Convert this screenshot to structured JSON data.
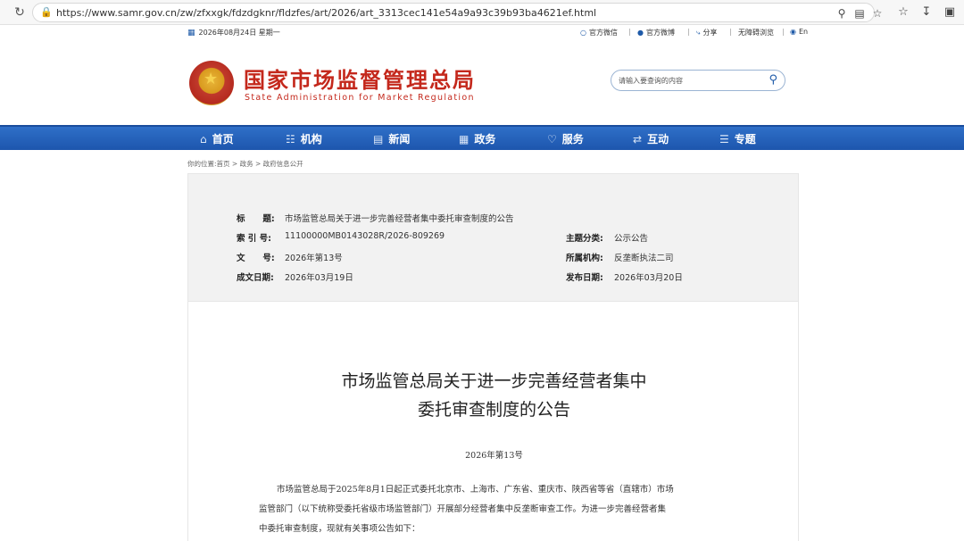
{
  "browser": {
    "url": "https://www.samr.gov.cn/zw/zfxxgk/fdzdgknr/fldzfes/art/2026/art_3313cec141e54a9a93c39b93ba4621ef.html"
  },
  "top_bar": {
    "date": "2026年08月24日 星期一",
    "links": [
      "官方微信",
      "官方微博",
      "分享",
      "无障碍浏览",
      "En"
    ]
  },
  "header": {
    "title": "国家市场监督管理总局",
    "subtitle": "State Administration for Market Regulation",
    "search_placeholder": "请输入要查询的内容"
  },
  "nav": {
    "items": [
      {
        "label": "首页",
        "icon": "home-icon"
      },
      {
        "label": "机构",
        "icon": "org-icon"
      },
      {
        "label": "新闻",
        "icon": "news-icon"
      },
      {
        "label": "政务",
        "icon": "gov-icon"
      },
      {
        "label": "服务",
        "icon": "service-icon"
      },
      {
        "label": "互动",
        "icon": "interact-icon"
      },
      {
        "label": "专题",
        "icon": "topic-icon"
      }
    ]
  },
  "breadcrumb": "你的位置:首页 > 政务 > 政府信息公开",
  "meta": {
    "title_label": "标      题:",
    "title_value": "市场监管总局关于进一步完善经营者集中委托审查制度的公告",
    "index_label": "索 引 号:",
    "index_value": "11100000MB0143028R/2026-809269",
    "doc_label": "文      号:",
    "doc_value": "2026年第13号",
    "date_label": "成文日期:",
    "date_value": "2026年03月19日",
    "topic_label": "主题分类:",
    "topic_value": "公示公告",
    "org_label": "所属机构:",
    "org_value": "反垄断执法二司",
    "publish_label": "发布日期:",
    "publish_value": "2026年03月20日"
  },
  "document": {
    "title_line1": "市场监管总局关于进一步完善经营者集中",
    "title_line2": "委托审查制度的公告",
    "number": "2026年第13号",
    "para_line1": "市场监管总局于2025年8月1日起正式委托北京市、上海市、广东省、重庆市、陕西省等省（直辖市）市场",
    "para_line2": "监管部门（以下统称受委托省级市场监管部门）开展部分经营者集中反垄断审查工作。为进一步完善经营者集",
    "para_line3": "中委托审查制度，现就有关事项公告如下："
  }
}
